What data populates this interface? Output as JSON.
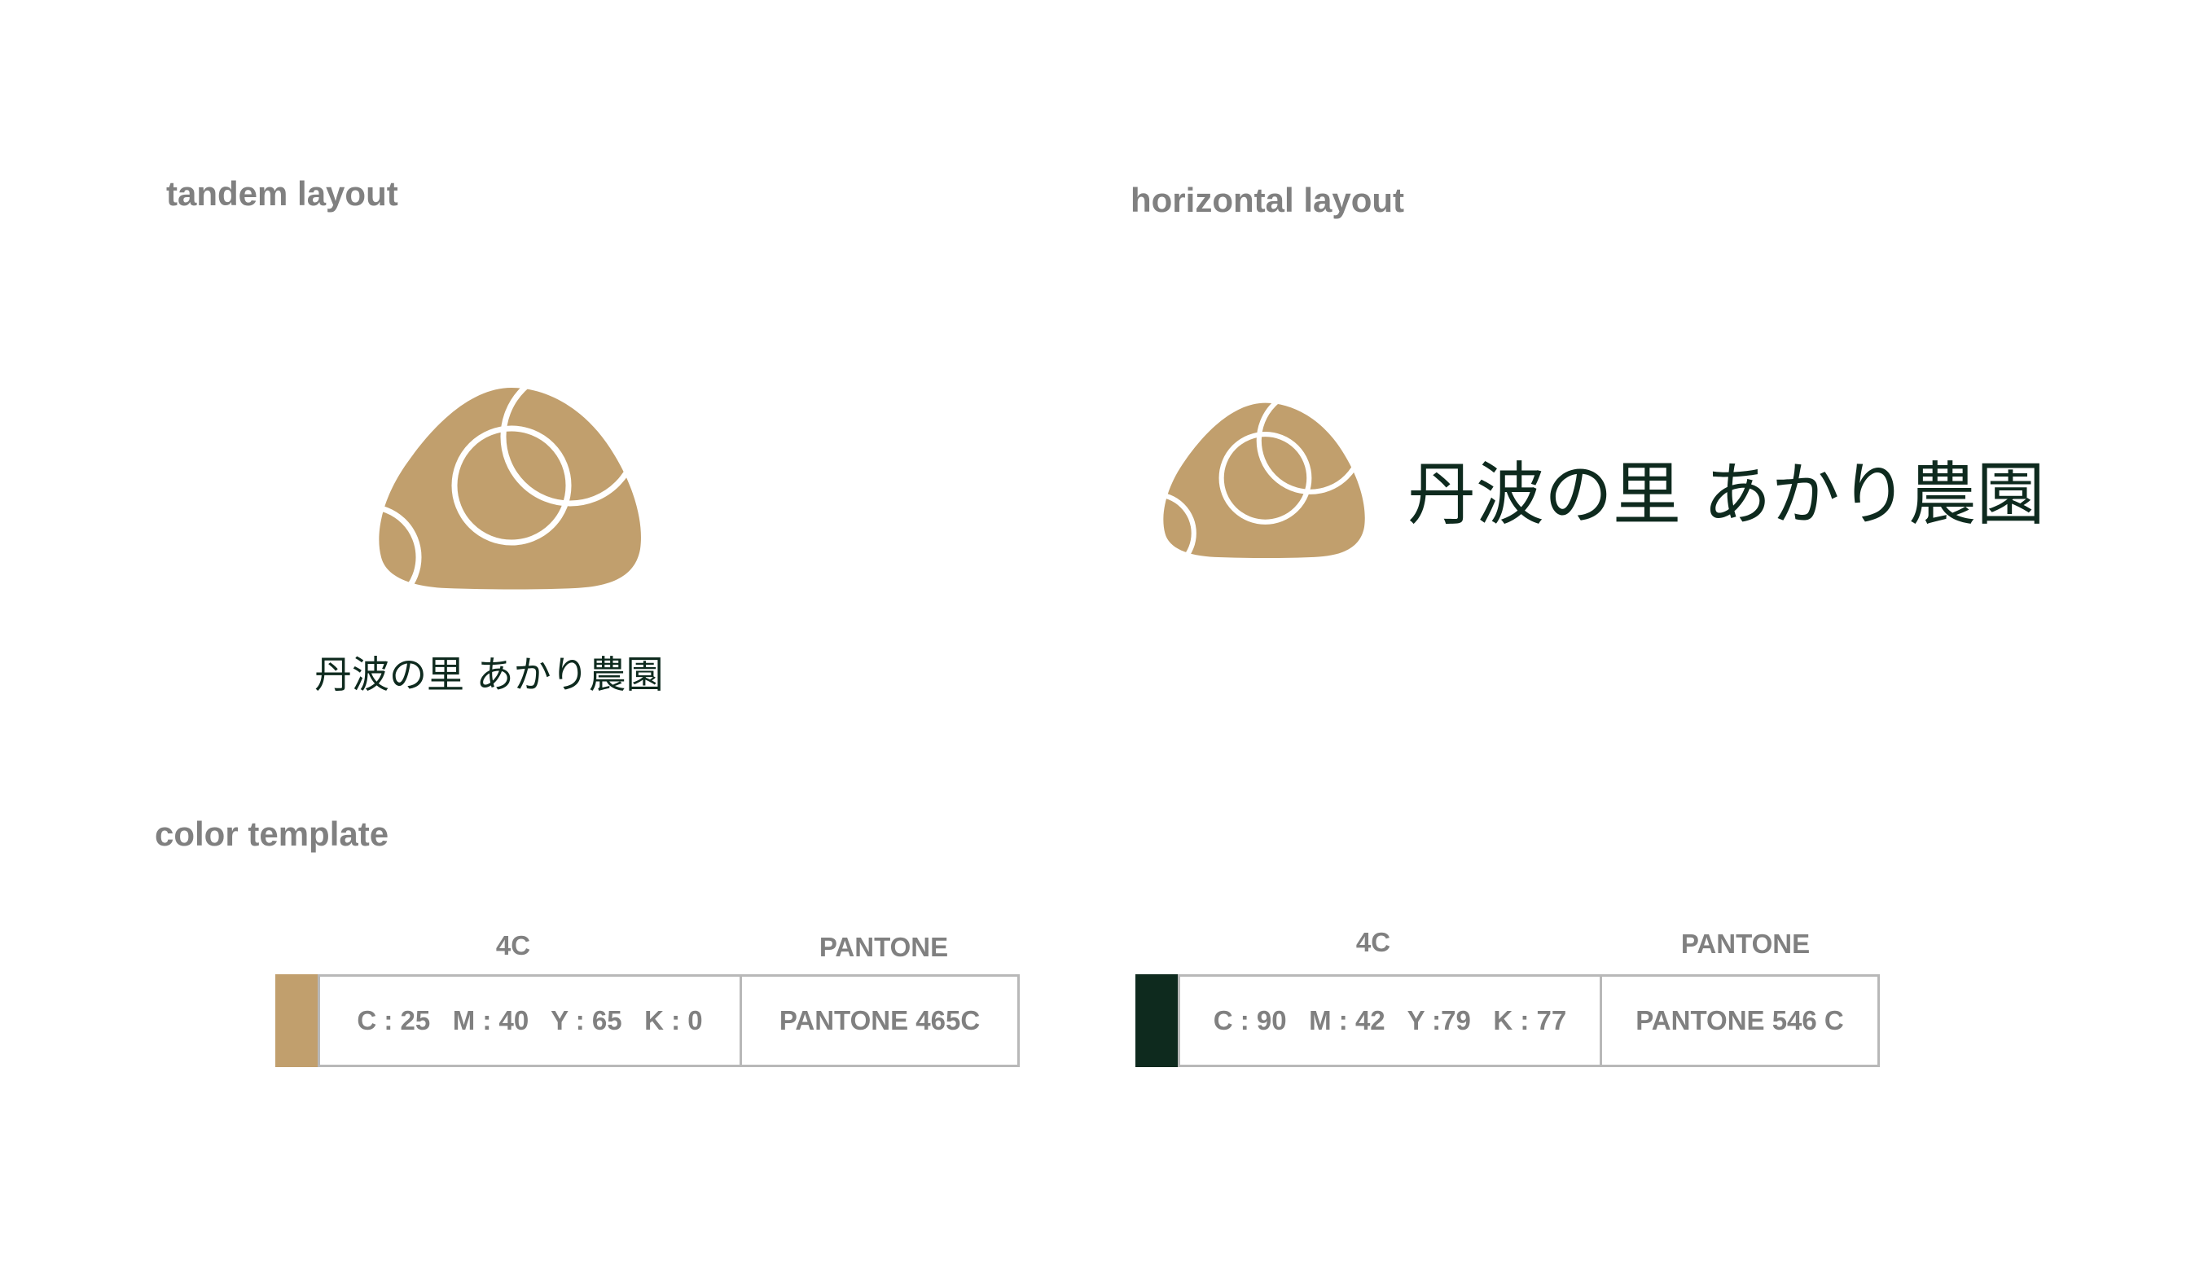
{
  "sections": {
    "tandem_title": "tandem layout",
    "horizontal_title": "horizontal layout",
    "color_title": "color template"
  },
  "brand": {
    "name": "丹波の里 あかり農園",
    "mark_color": "#c19f6d",
    "text_color": "#0e2a1e"
  },
  "colors": [
    {
      "swatch": "#c19f6d",
      "head_4c": "4C",
      "head_pantone": "PANTONE",
      "cmyk": "C : 25   M : 40   Y : 65   K : 0",
      "pantone": "PANTONE 465C"
    },
    {
      "swatch": "#0e2a1e",
      "head_4c": "4C",
      "head_pantone": "PANTONE",
      "cmyk": "C : 90   M : 42   Y :79   K : 77",
      "pantone": "PANTONE 546 C"
    }
  ]
}
